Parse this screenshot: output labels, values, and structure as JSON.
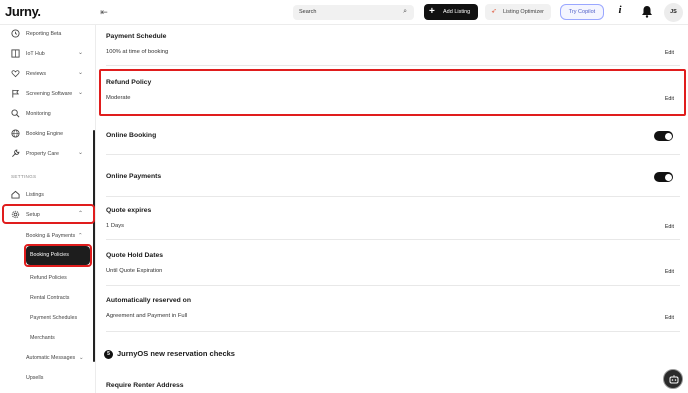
{
  "header": {
    "logo": "Jurny.",
    "search_placeholder": "Search",
    "add_listing": "Add Listing",
    "listing_optimizer": "Listing Optimizer",
    "try_copilot": "Try Copilot",
    "avatar_initials": "JS"
  },
  "sidebar": {
    "items": [
      {
        "label": "Reporting Beta",
        "icon": "clock-icon"
      },
      {
        "label": "IoT Hub",
        "icon": "grid-icon"
      },
      {
        "label": "Reviews",
        "icon": "heart-icon"
      },
      {
        "label": "Screening Software",
        "icon": "flag-icon"
      },
      {
        "label": "Monitoring",
        "icon": "search-icon"
      },
      {
        "label": "Booking Engine",
        "icon": "globe-icon"
      },
      {
        "label": "Property Care",
        "icon": "wrench-icon"
      }
    ],
    "settings_heading": "SETTINGS",
    "listings": "Listings",
    "setup": "Setup",
    "booking_payments": "Booking & Payments",
    "sub_items": [
      "Booking Policies",
      "Refund Policies",
      "Rental Contracts",
      "Payment Schedules",
      "Merchants"
    ],
    "automatic_messages": "Automatic Messages",
    "upsells": "Upsells"
  },
  "main": {
    "payment_schedule": {
      "title": "Payment Schedule",
      "value": "100% at time of booking",
      "edit": "Edit"
    },
    "refund_policy": {
      "title": "Refund Policy",
      "value": "Moderate",
      "edit": "Edit"
    },
    "online_booking": {
      "title": "Online Booking",
      "enabled": true
    },
    "online_payments": {
      "title": "Online Payments",
      "enabled": true
    },
    "quote_expires": {
      "title": "Quote expires",
      "value": "1 Days",
      "edit": "Edit"
    },
    "quote_hold": {
      "title": "Quote Hold Dates",
      "value": "Until Quote Expiration",
      "edit": "Edit"
    },
    "auto_reserved": {
      "title": "Automatically reserved on",
      "value": "Agreement and Payment in Full",
      "edit": "Edit"
    },
    "checks": {
      "number": "5",
      "title": "JurnyOS new reservation checks"
    },
    "require_address": {
      "title": "Require Renter Address"
    }
  },
  "colors": {
    "highlight": "#e01d1d",
    "accent": "#111111",
    "copilot": "#4f5ec8"
  }
}
